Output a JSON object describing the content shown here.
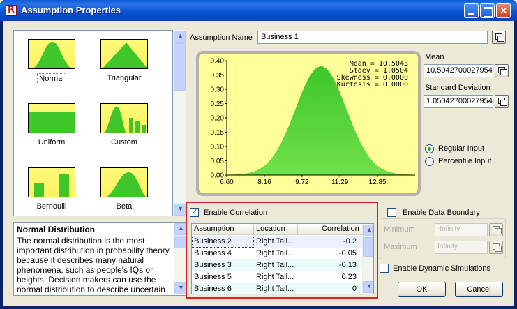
{
  "window": {
    "title": "Assumption Properties"
  },
  "gallery": {
    "items": [
      {
        "label": "Normal",
        "selected": true
      },
      {
        "label": "Triangular"
      },
      {
        "label": "Uniform"
      },
      {
        "label": "Custom"
      },
      {
        "label": "Bernoulli"
      },
      {
        "label": "Beta"
      }
    ]
  },
  "description": {
    "title": "Normal Distribution",
    "body": "The normal distribution is the most important distribution in probability theory because it describes many natural phenomena, such as people's IQs or heights. Decision makers can use the normal distribution to describe uncertain"
  },
  "assumption": {
    "name_label": "Assumption Name",
    "name_value": "Business 1"
  },
  "chart_data": {
    "type": "area",
    "distribution": "normal",
    "mean": 10.5043,
    "stdev": 1.0504,
    "y_ticks": [
      "0.00",
      "0.05",
      "0.10",
      "0.15",
      "0.20",
      "0.25",
      "0.30",
      "0.35",
      "0.40"
    ],
    "x_ticks": [
      "6.60",
      "8.16",
      "9.72",
      "11.29",
      "12.85"
    ],
    "xlim": [
      6.6,
      14.41
    ],
    "ylim": [
      0,
      0.4
    ],
    "fill_color": "#3ec62b",
    "stats": [
      "Mean = 10.5043",
      "Stdev = 1.0504",
      "Skewness = 0.0000",
      "Kurtosis = 0.0000"
    ]
  },
  "parameters": {
    "mean_label": "Mean",
    "mean_value": "10.5042700027954",
    "stdev_label": "Standard Deviation",
    "stdev_value": "1.05042700027954"
  },
  "input_mode": {
    "regular": "Regular Input",
    "percentile": "Percentile Input",
    "selected": "regular"
  },
  "correlation": {
    "enable_label": "Enable Correlation",
    "enabled": true,
    "columns": [
      "Assumption",
      "Location",
      "Correlation"
    ],
    "rows": [
      {
        "assumption": "Business 2",
        "location": "Right  Tail...",
        "correlation": "-0.2"
      },
      {
        "assumption": "Business 4",
        "location": "Right  Tail...",
        "correlation": "-0.05"
      },
      {
        "assumption": "Business 3",
        "location": "Right  Tail...",
        "correlation": "-0.13"
      },
      {
        "assumption": "Business 5",
        "location": "Right  Tail...",
        "correlation": "0.23"
      },
      {
        "assumption": "Business 6",
        "location": "Right  Tail...",
        "correlation": "0"
      }
    ]
  },
  "boundary": {
    "enable_label": "Enable Data Boundary",
    "minimum_label": "Minimum",
    "minimum_value": "-Infinity",
    "maximum_label": "Maximum",
    "maximum_value": "Infinity"
  },
  "dynamic": {
    "label": "Enable Dynamic Simulations"
  },
  "buttons": {
    "ok": "OK",
    "cancel": "Cancel"
  }
}
